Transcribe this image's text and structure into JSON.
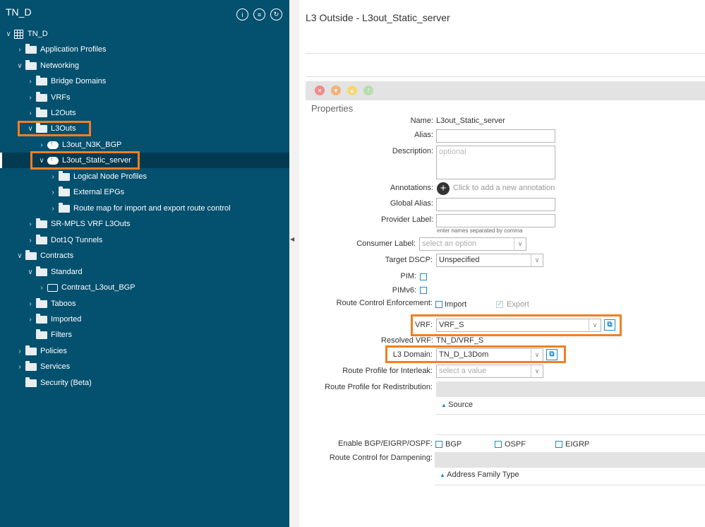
{
  "sidebar": {
    "title": "TN_D",
    "items": [
      {
        "label": "TN_D",
        "icon": "tenant-grid-icon"
      },
      {
        "label": "Application Profiles",
        "icon": "folder-icon"
      },
      {
        "label": "Networking",
        "icon": "folder-icon"
      },
      {
        "label": "Bridge Domains",
        "icon": "folder-icon"
      },
      {
        "label": "VRFs",
        "icon": "folder-icon"
      },
      {
        "label": "L2Outs",
        "icon": "folder-icon"
      },
      {
        "label": "L3Outs",
        "icon": "folder-icon"
      },
      {
        "label": "L3out_N3K_BGP",
        "icon": "cloud-icon"
      },
      {
        "label": "L3out_Static_server",
        "icon": "cloud-icon"
      },
      {
        "label": "Logical Node Profiles",
        "icon": "folder-icon"
      },
      {
        "label": "External EPGs",
        "icon": "folder-icon"
      },
      {
        "label": "Route map for import and export route control",
        "icon": "folder-icon"
      },
      {
        "label": "SR-MPLS VRF L3Outs",
        "icon": "folder-icon"
      },
      {
        "label": "Dot1Q Tunnels",
        "icon": "folder-icon"
      },
      {
        "label": "Contracts",
        "icon": "folder-icon"
      },
      {
        "label": "Standard",
        "icon": "folder-icon"
      },
      {
        "label": "Contract_L3out_BGP",
        "icon": "contract-icon"
      },
      {
        "label": "Taboos",
        "icon": "folder-icon"
      },
      {
        "label": "Imported",
        "icon": "folder-icon"
      },
      {
        "label": "Filters",
        "icon": "folder-icon"
      },
      {
        "label": "Policies",
        "icon": "folder-icon"
      },
      {
        "label": "Services",
        "icon": "folder-icon"
      },
      {
        "label": "Security (Beta)",
        "icon": "folder-icon"
      }
    ]
  },
  "main": {
    "title": "L3 Outside - L3out_Static_server",
    "section": "Properties",
    "fields": {
      "name_label": "Name:",
      "name_value": "L3out_Static_server",
      "alias_label": "Alias:",
      "description_label": "Description:",
      "description_placeholder": "optional",
      "annotations_label": "Annotations:",
      "annotations_hint": "Click to add a new annotation",
      "global_alias_label": "Global Alias:",
      "provider_label": "Provider Label:",
      "provider_hint": "enter names separated by comma",
      "consumer_label": "Consumer Label:",
      "consumer_placeholder": "select an option",
      "target_dscp_label": "Target DSCP:",
      "target_dscp_value": "Unspecified",
      "pim_label": "PIM:",
      "pimv6_label": "PIMv6:",
      "rce_label": "Route Control Enforcement:",
      "rce_import": "Import",
      "rce_export": "Export",
      "vrf_label": "VRF:",
      "vrf_value": "VRF_S",
      "resolved_vrf_label": "Resolved VRF:",
      "resolved_vrf_value": "TN_D/VRF_S",
      "l3domain_label": "L3 Domain:",
      "l3domain_value": "TN_D_L3Dom",
      "interleak_label": "Route Profile for Interleak:",
      "interleak_placeholder": "select a value",
      "redistribution_label": "Route Profile for Redistribution:",
      "source_label": "Source",
      "bgp_label": "Enable BGP/EIGRP/OSPF:",
      "bgp": "BGP",
      "ospf": "OSPF",
      "eigrp": "EIGRP",
      "dampening_label": "Route Control for Dampening:",
      "address_family_label": "Address Family Type"
    }
  },
  "colors": {
    "sidebar_bg": "#04506f",
    "highlight": "#f08023",
    "link": "#1b8bc6"
  }
}
